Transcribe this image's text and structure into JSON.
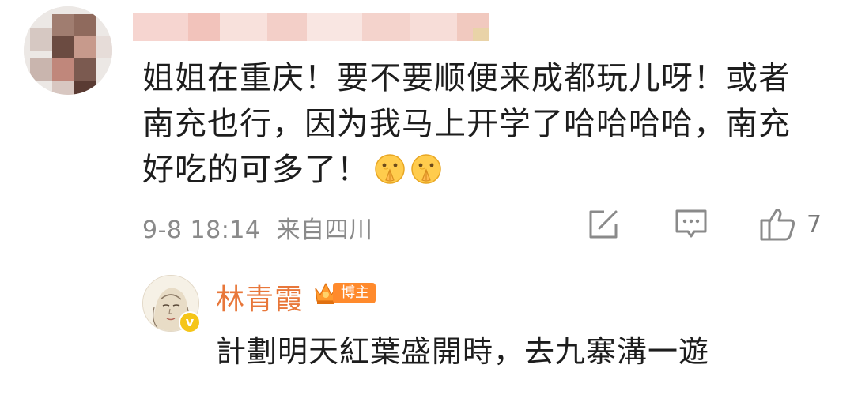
{
  "comment": {
    "text": "姐姐在重庆！要不要顺便来成都玩儿呀！或者南充也行，因为我马上开学了哈哈哈哈，南充好吃的可多了！",
    "emojis": [
      "pray-emoji",
      "pray-emoji"
    ],
    "timestamp": "9-8 18:14",
    "location": "来自四川",
    "like_count": "7"
  },
  "reply": {
    "author": "林青霞",
    "badge": "博主",
    "text": "計劃明天紅葉盛開時，去九寨溝一遊"
  },
  "icons": {
    "share": "share-icon",
    "comment": "comment-icon",
    "like": "thumbs-up-icon",
    "verified": "verified-icon",
    "crown": "crown-icon"
  },
  "colors": {
    "text_primary": "#1d1d1d",
    "text_meta": "#8a8a8a",
    "reply_name": "#e8773a",
    "badge_bg": "#ff8a2c"
  }
}
